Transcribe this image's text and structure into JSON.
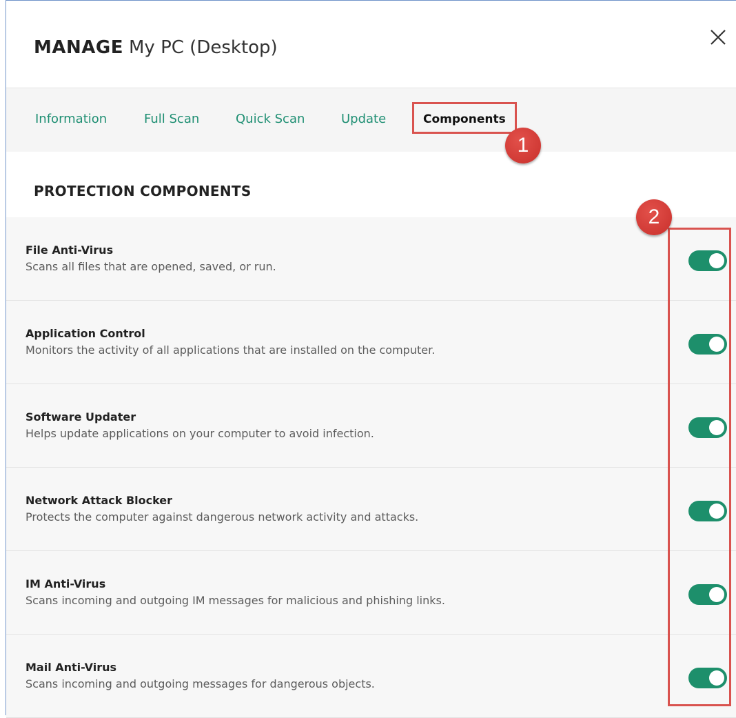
{
  "header": {
    "title": "MANAGE",
    "subtitle": "My PC (Desktop)",
    "close_icon": "close-icon"
  },
  "tabs": [
    {
      "label": "Information",
      "active": false
    },
    {
      "label": "Full Scan",
      "active": false
    },
    {
      "label": "Quick Scan",
      "active": false
    },
    {
      "label": "Update",
      "active": false
    },
    {
      "label": "Components",
      "active": true
    }
  ],
  "section": {
    "title": "PROTECTION COMPONENTS"
  },
  "components": [
    {
      "name": "File Anti-Virus",
      "description": "Scans all files that are opened, saved, or run.",
      "enabled": true
    },
    {
      "name": "Application Control",
      "description": "Monitors the activity of all applications that are installed on the computer.",
      "enabled": true
    },
    {
      "name": "Software Updater",
      "description": "Helps update applications on your computer to avoid infection.",
      "enabled": true
    },
    {
      "name": "Network Attack Blocker",
      "description": "Protects the computer against dangerous network activity and attacks.",
      "enabled": true
    },
    {
      "name": "IM Anti-Virus",
      "description": "Scans incoming and outgoing IM messages for malicious and phishing links.",
      "enabled": true
    },
    {
      "name": "Mail Anti-Virus",
      "description": "Scans incoming and outgoing messages for dangerous objects.",
      "enabled": true
    }
  ],
  "annotations": {
    "badge_1": "1",
    "badge_2": "2"
  },
  "colors": {
    "accent": "#1d8f6b",
    "tab_text": "#1f8f73",
    "annotation_red": "#d9534f"
  }
}
